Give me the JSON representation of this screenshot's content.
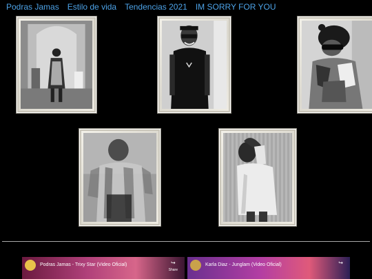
{
  "nav": {
    "items": [
      "Podras Jamas",
      "Estilo de vida",
      "Tendencias 2021",
      "IM SORRY FOR YOU"
    ]
  },
  "gallery": {
    "photos": [
      {
        "name": "photo-1",
        "subject": "person-in-hallway"
      },
      {
        "name": "photo-2",
        "subject": "man-sunglasses-smiling"
      },
      {
        "name": "photo-3",
        "subject": "person-beanie-sunglasses"
      },
      {
        "name": "photo-4",
        "subject": "blurred-dancer"
      },
      {
        "name": "photo-5",
        "subject": "man-hand-on-head"
      }
    ]
  },
  "videos": [
    {
      "title": "Podras Jamas - Trixy Star (Video Oficial)",
      "share_label": "Share",
      "icon": "share-icon"
    },
    {
      "title": "Karla Diaz - Junglam (Video Oficial)",
      "share_label": "",
      "icon": "share-icon"
    }
  ],
  "colors": {
    "nav_link": "#4da3e8",
    "background": "#000000",
    "frame": "#e8e5dc"
  }
}
